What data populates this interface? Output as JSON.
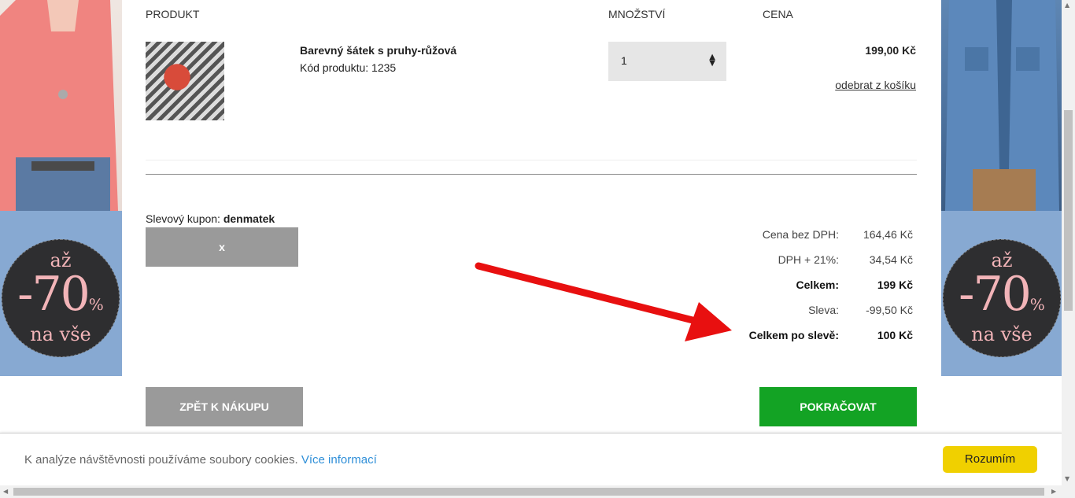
{
  "table_header": {
    "product": "PRODUKT",
    "quantity": "MNOŽSTVÍ",
    "price": "CENA"
  },
  "item": {
    "name": "Barevný šátek s pruhy-růžová",
    "code": "Kód produktu: 1235",
    "quantity": "1",
    "price": "199,00 Kč",
    "remove": "odebrat z košíku"
  },
  "coupon": {
    "label": "Slevový kupon:",
    "code": "denmatek",
    "remove_label": "x"
  },
  "summary": [
    {
      "label": "Cena bez DPH:",
      "value": "164,46 Kč",
      "bold": false
    },
    {
      "label": "DPH + 21%:",
      "value": "34,54 Kč",
      "bold": false
    },
    {
      "label": "Celkem:",
      "value": "199 Kč",
      "bold": true
    },
    {
      "label": "Sleva:",
      "value": "-99,50 Kč",
      "bold": false
    },
    {
      "label": "Celkem po slevě:",
      "value": "100 Kč",
      "bold": true
    }
  ],
  "buttons": {
    "back": "ZPĚT K NÁKUPU",
    "continue": "POKRAČOVAT"
  },
  "promo": {
    "prefix": "až",
    "amount": "-70",
    "percent": "%",
    "suffix": "na vše"
  },
  "cookie": {
    "message": "K analýze návštěvnosti používáme soubory cookies.",
    "more": "Více informací",
    "accept": "Rozumím"
  },
  "colors": {
    "continue_button": "#13a324",
    "secondary_button": "#9a9a9a",
    "cookie_button": "#f0d000",
    "arrow": "#e81010",
    "promo_bg": "#87a9d2"
  }
}
